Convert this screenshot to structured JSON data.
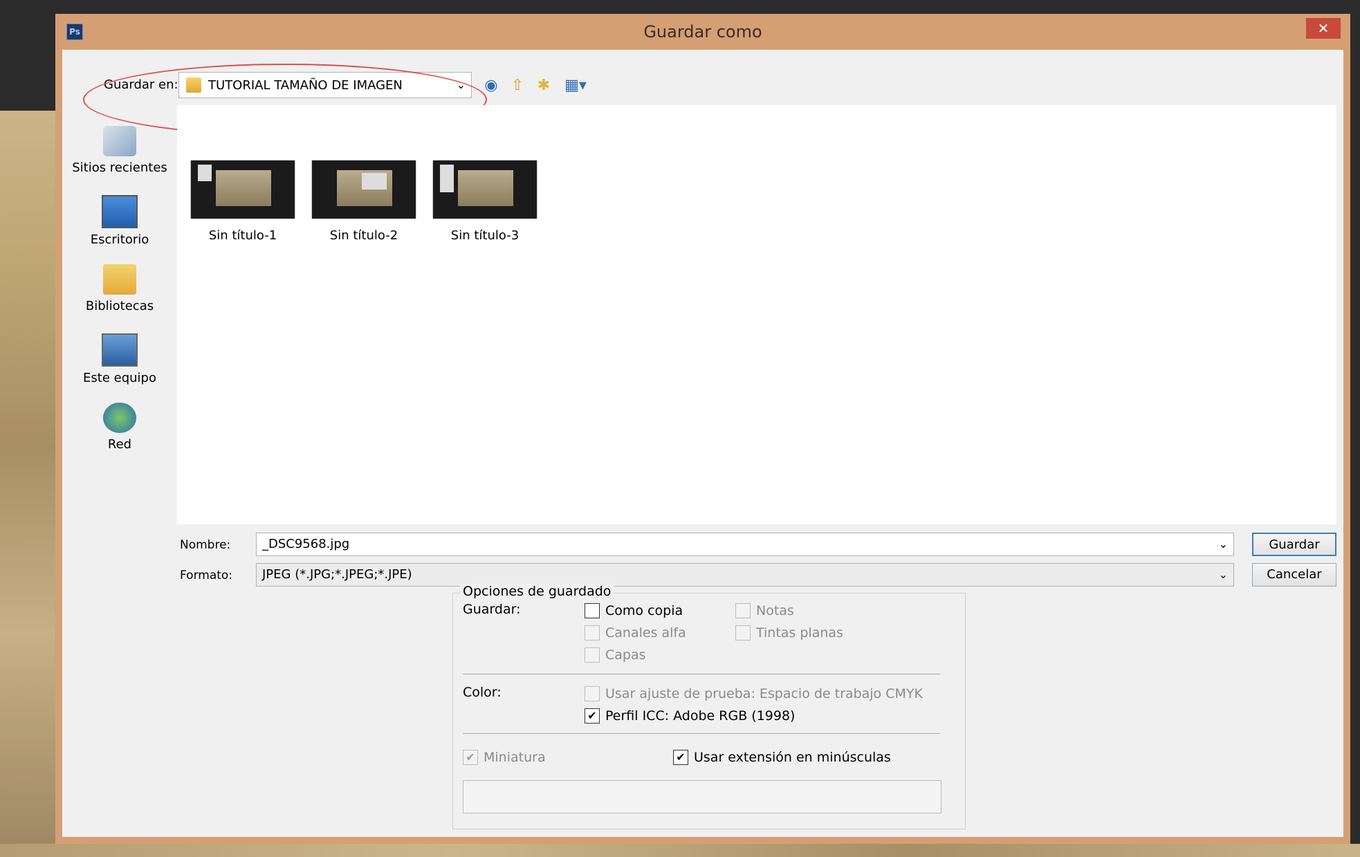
{
  "window": {
    "title": "Guardar como",
    "close": "✕",
    "app_icon": "Ps"
  },
  "location": {
    "label": "Guardar en:",
    "value": "TUTORIAL TAMAÑO DE IMAGEN"
  },
  "toolbar": {
    "icons": [
      "back-icon",
      "up-folder-icon",
      "new-folder-icon",
      "view-menu-icon"
    ]
  },
  "places": [
    {
      "label": "Sitios recientes",
      "icon": "recent-places-icon"
    },
    {
      "label": "Escritorio",
      "icon": "desktop-icon"
    },
    {
      "label": "Bibliotecas",
      "icon": "libraries-icon"
    },
    {
      "label": "Este equipo",
      "icon": "this-pc-icon"
    },
    {
      "label": "Red",
      "icon": "network-icon"
    }
  ],
  "files": [
    {
      "name": "Sin título-1"
    },
    {
      "name": "Sin título-2"
    },
    {
      "name": "Sin título-3"
    }
  ],
  "fields": {
    "name_label": "Nombre:",
    "name_value": "_DSC9568.jpg",
    "format_label": "Formato:",
    "format_value": "JPEG (*.JPG;*.JPEG;*.JPE)"
  },
  "buttons": {
    "save": "Guardar",
    "cancel": "Cancelar"
  },
  "options": {
    "title": "Opciones de guardado",
    "save_label": "Guardar:",
    "como_copia": {
      "label": "Como copia",
      "checked": false,
      "enabled": true
    },
    "notas": {
      "label": "Notas",
      "checked": false,
      "enabled": false
    },
    "canales_alfa": {
      "label": "Canales alfa",
      "checked": false,
      "enabled": false
    },
    "tintas_planas": {
      "label": "Tintas planas",
      "checked": false,
      "enabled": false
    },
    "capas": {
      "label": "Capas",
      "checked": false,
      "enabled": false
    },
    "color_label": "Color:",
    "ajuste_prueba": {
      "label": "Usar ajuste de prueba: Espacio de trabajo CMYK",
      "checked": false,
      "enabled": false
    },
    "perfil_icc": {
      "label": "Perfil ICC: Adobe RGB (1998)",
      "checked": true,
      "enabled": true
    },
    "miniatura": {
      "label": "Miniatura",
      "checked": true,
      "enabled": false
    },
    "minusculas": {
      "label": "Usar extensión en minúsculas",
      "checked": true,
      "enabled": true
    }
  },
  "colors": {
    "annotation": "#e04b4b",
    "title_bar": "#d59f74"
  }
}
